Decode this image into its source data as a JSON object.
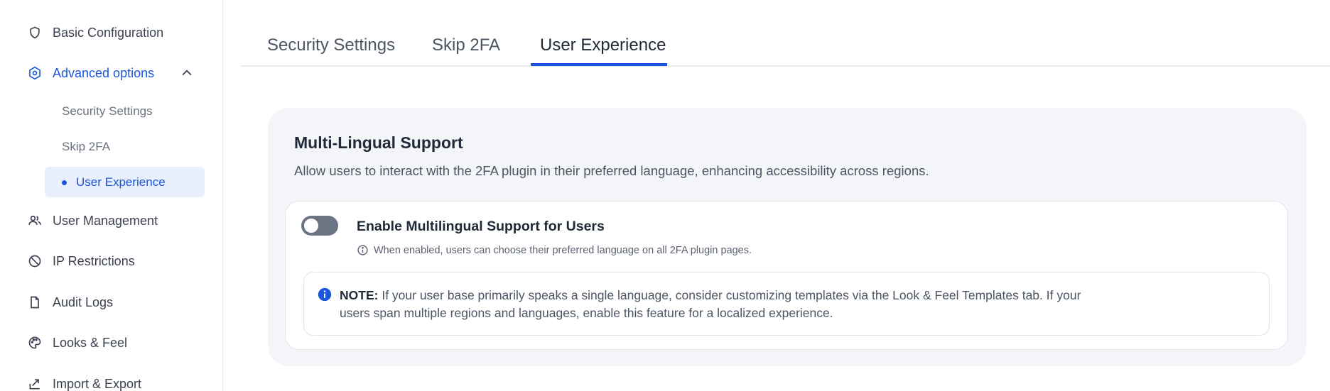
{
  "sidebar": {
    "items": [
      {
        "label": "Basic Configuration",
        "icon": "shield-icon"
      },
      {
        "label": "Advanced options",
        "icon": "settings-hex-icon",
        "expanded": true
      },
      {
        "label": "User Management",
        "icon": "users-icon"
      },
      {
        "label": "IP Restrictions",
        "icon": "ban-icon"
      },
      {
        "label": "Audit Logs",
        "icon": "file-icon"
      },
      {
        "label": "Looks & Feel",
        "icon": "palette-icon"
      },
      {
        "label": "Import & Export",
        "icon": "export-icon"
      }
    ],
    "subitems": [
      {
        "label": "Security Settings"
      },
      {
        "label": "Skip 2FA"
      },
      {
        "label": "User Experience",
        "active": true
      }
    ]
  },
  "tabs": [
    {
      "label": "Security Settings"
    },
    {
      "label": "Skip 2FA"
    },
    {
      "label": "User Experience",
      "active": true
    }
  ],
  "card": {
    "title": "Multi-Lingual Support",
    "description": "Allow users to interact with the 2FA plugin in their preferred language, enhancing accessibility across regions.",
    "toggle_label": "Enable Multilingual Support for Users",
    "toggle_state": "off",
    "hint": "When enabled, users can choose their preferred language on all 2FA plugin pages.",
    "note_label": "NOTE:",
    "note_text": "If your user base primarily speaks a single language, consider customizing templates via the Look & Feel Templates tab. If your users span multiple regions and languages, enable this feature for a localized experience."
  },
  "colors": {
    "accent": "#1a56db",
    "active_bg": "#e9effd",
    "card_bg": "#f4f5f8",
    "toggle_off": "#6b7483"
  }
}
